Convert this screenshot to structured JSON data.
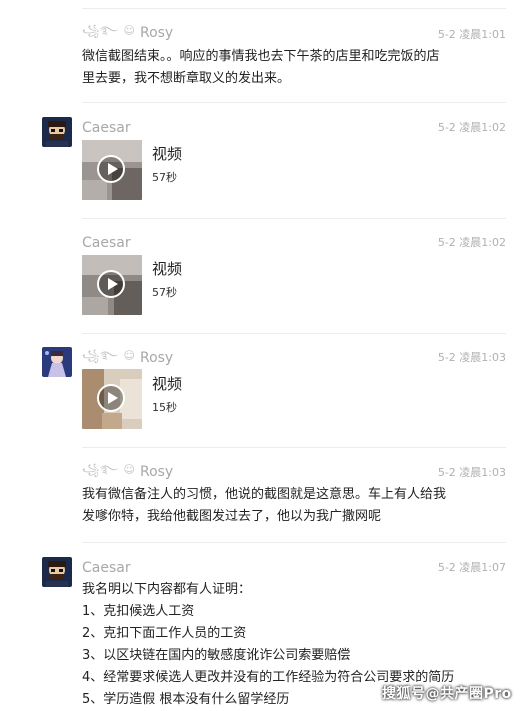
{
  "messages": [
    {
      "name": "Rosy",
      "name_decoration": "꧁࿐ ☺",
      "time": "5-2 凌晨1:01",
      "text_lines": [
        "微信截图结束。。响应的事情我也去下午茶的店里和吃完饭的店",
        "里去要，我不想断章取义的发出来。"
      ]
    },
    {
      "name": "Caesar",
      "time": "5-2 凌晨1:02",
      "video_title": "视频",
      "video_duration": "57秒"
    },
    {
      "name": "Caesar",
      "time": "5-2 凌晨1:02",
      "video_title": "视频",
      "video_duration": "57秒"
    },
    {
      "name": "Rosy",
      "name_decoration": "꧁࿐ ☺",
      "time": "5-2 凌晨1:03",
      "video_title": "视频",
      "video_duration": "15秒"
    },
    {
      "name": "Rosy",
      "name_decoration": "꧁࿐ ☺",
      "time": "5-2 凌晨1:03",
      "text_lines": [
        "我有微信备注人的习惯，他说的截图就是这意思。车上有人给我",
        "发嗲你特，我给他截图发过去了，他以为我广撒网呢"
      ]
    },
    {
      "name": "Caesar",
      "time": "5-2 凌晨1:07",
      "text_lines": [
        "我名明以下内容都有人证明：",
        "1、克扣候选人工资",
        "2、克扣下面工作人员的工资",
        "3、以区块链在国内的敏感度讹诈公司索要赔偿",
        "4、经常要求候选人更改并没有的工作经验为符合公司要求的简历",
        "5、学历造假 根本没有什么留学经历"
      ]
    }
  ],
  "watermark": "搜狐号@共产圈Pro",
  "colors": {
    "name": "#a8a8a8",
    "time": "#b0b0b0",
    "text": "#222222",
    "divider": "#ececec"
  }
}
